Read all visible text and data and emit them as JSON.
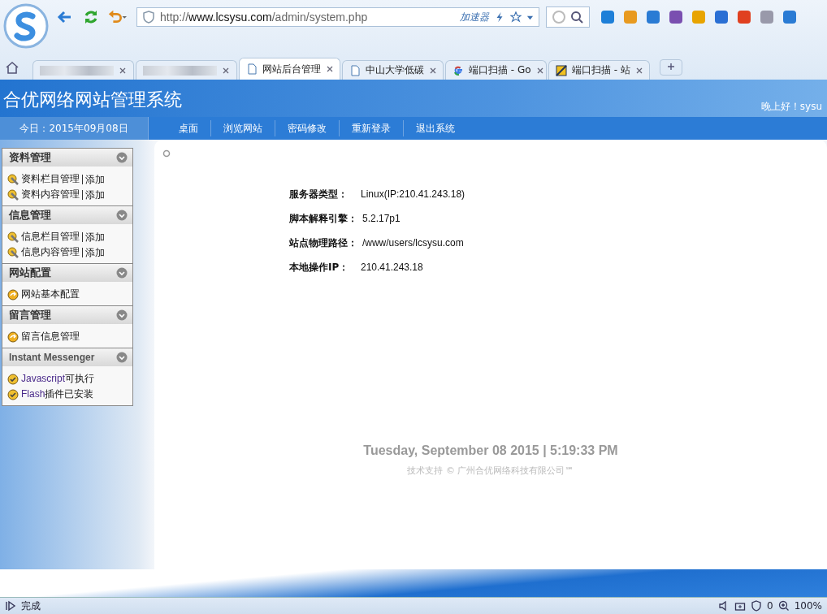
{
  "browser": {
    "url_parts": [
      {
        "text": "http://",
        "kind": "dim"
      },
      {
        "text": "www.lcsysu.com",
        "kind": "host"
      },
      {
        "text": "/admin/system.php",
        "kind": "dim"
      }
    ],
    "accelerator": "加速器",
    "tabs": [
      {
        "selected": false,
        "kind": "blurred"
      },
      {
        "selected": false,
        "kind": "blurred"
      },
      {
        "label": "网站后台管理",
        "selected": true,
        "kind": "page"
      },
      {
        "label": "中山大学低碳",
        "selected": false,
        "kind": "page"
      },
      {
        "label": "端口扫描 - Go",
        "selected": false,
        "kind": "google"
      },
      {
        "label": "端口扫描 - 站",
        "selected": false,
        "kind": "site"
      }
    ]
  },
  "site": {
    "title": "合优网络网站管理系统",
    "greeting": "晚上好！sysu",
    "today": "今日：2015年09月08日",
    "nav": [
      "桌面",
      "浏览网站",
      "密码修改",
      "重新登录",
      "退出系统"
    ],
    "sidebar": [
      {
        "title": "资料管理",
        "kind": "normal",
        "items": [
          {
            "kind": "edit",
            "label": "资料栏目管理",
            "link": "添加"
          },
          {
            "kind": "edit",
            "label": "资料内容管理",
            "link": "添加"
          }
        ]
      },
      {
        "title": "信息管理",
        "kind": "normal",
        "items": [
          {
            "kind": "edit",
            "label": "信息栏目管理",
            "link": "添加"
          },
          {
            "kind": "edit",
            "label": "信息内容管理",
            "link": "添加"
          }
        ]
      },
      {
        "title": "网站配置",
        "kind": "normal",
        "items": [
          {
            "kind": "config",
            "label": "网站基本配置"
          }
        ]
      },
      {
        "title": "留言管理",
        "kind": "normal",
        "items": [
          {
            "kind": "config",
            "label": "留言信息管理"
          }
        ]
      },
      {
        "title": "Instant Messenger",
        "kind": "latin",
        "items": [
          {
            "kind": "status",
            "name": "Javascript",
            "label": "可执行"
          },
          {
            "kind": "status",
            "name": "Flash",
            "label": "插件已安装"
          }
        ]
      }
    ],
    "info": [
      {
        "label": "服务器类型：",
        "value": "Linux(IP:210.41.243.18)"
      },
      {
        "label": "脚本解释引擎：",
        "value": "5.2.17p1"
      },
      {
        "label": "站点物理路径：",
        "value": "/www/users/lcsysu.com"
      },
      {
        "label": "本地操作IP：",
        "value": "210.41.243.18"
      }
    ],
    "clock": "Tuesday, September 08 2015 | 5:19:33 PM",
    "support": "技术支持 © 广州合优网络科技有限公司℠"
  },
  "status_bar": {
    "text": "完成",
    "ad_count": "0",
    "zoom": "100%"
  }
}
